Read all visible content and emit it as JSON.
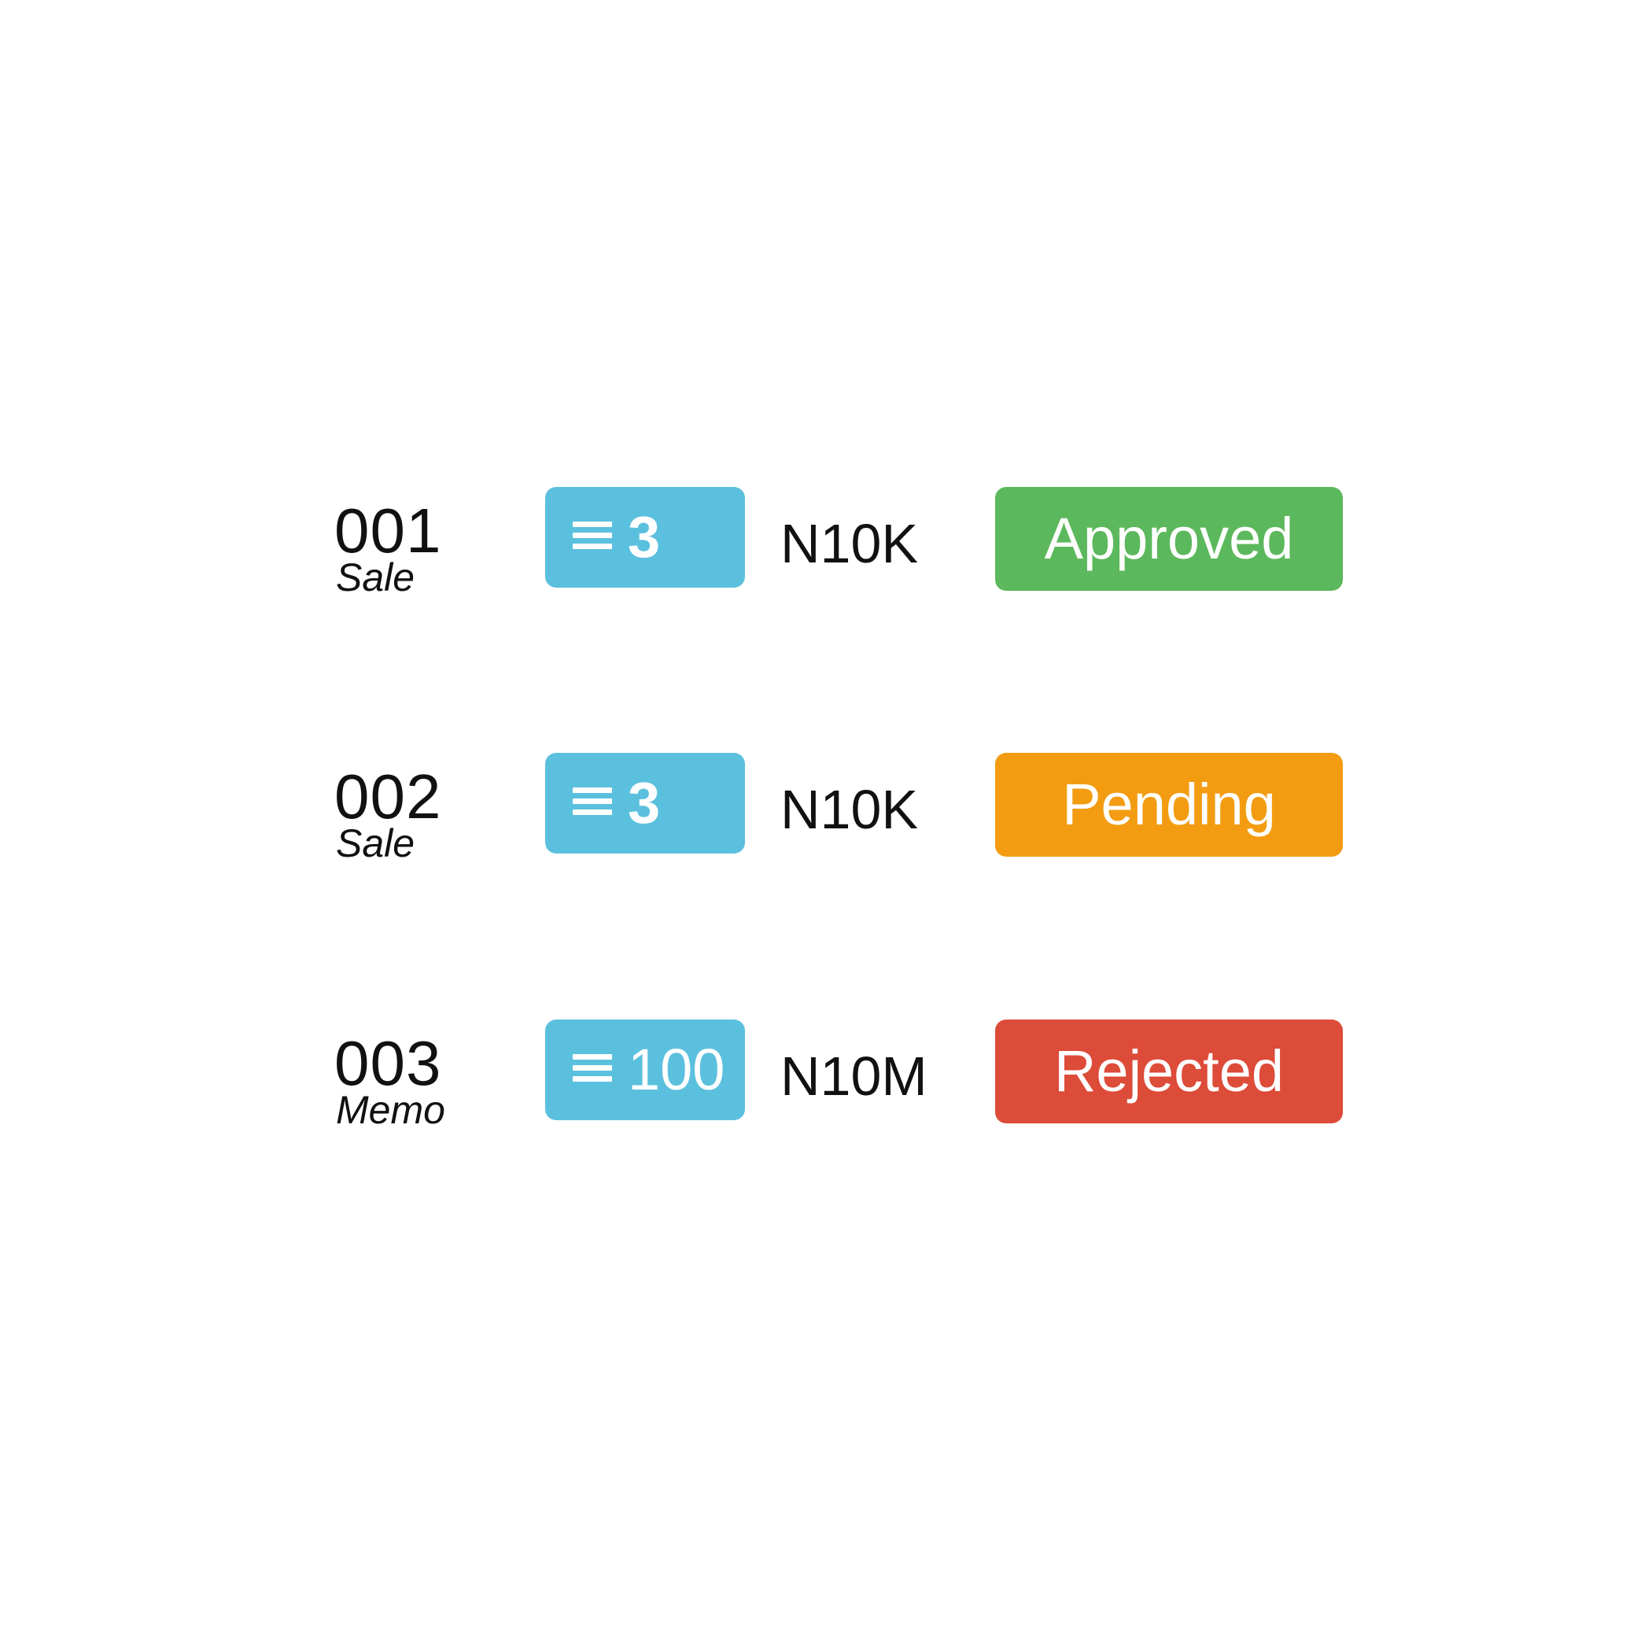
{
  "rows": [
    {
      "id": "001",
      "type": "Sale",
      "quantity": "3",
      "amount": "N10K",
      "status": {
        "label": "Approved",
        "color": "#5cb85c"
      }
    },
    {
      "id": "002",
      "type": "Sale",
      "quantity": "3",
      "amount": "N10K",
      "status": {
        "label": "Pending",
        "color": "#f39c12"
      }
    },
    {
      "id": "003",
      "type": "Memo",
      "quantity": "100",
      "amount": "N10M",
      "status": {
        "label": "Rejected",
        "color": "#dd4b39"
      }
    }
  ],
  "colors": {
    "quantity_badge": "#5bc0de",
    "text": "#111111",
    "background": "#ffffff"
  },
  "icons": {
    "quantity": "menu-lines-icon"
  }
}
